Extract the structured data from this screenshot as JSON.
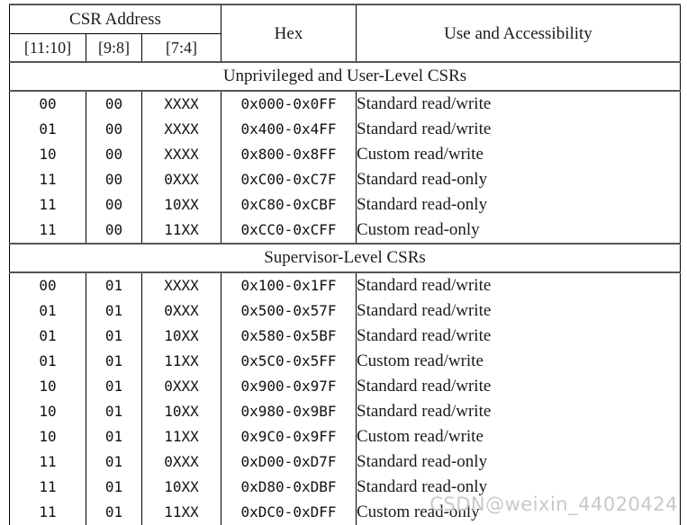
{
  "table": {
    "header": {
      "csr_address": "CSR Address",
      "bits_1": "[11:10]",
      "bits_2": "[9:8]",
      "bits_3": "[7:4]",
      "hex": "Hex",
      "use": "Use and Accessibility"
    },
    "sections": [
      {
        "title": "Unprivileged and User-Level CSRs",
        "rows": [
          {
            "bits1": "00",
            "bits2": "00",
            "bits3": "XXXX",
            "hex": "0x000-0x0FF",
            "use": "Standard read/write"
          },
          {
            "bits1": "01",
            "bits2": "00",
            "bits3": "XXXX",
            "hex": "0x400-0x4FF",
            "use": "Standard read/write"
          },
          {
            "bits1": "10",
            "bits2": "00",
            "bits3": "XXXX",
            "hex": "0x800-0x8FF",
            "use": "Custom read/write"
          },
          {
            "bits1": "11",
            "bits2": "00",
            "bits3": "0XXX",
            "hex": "0xC00-0xC7F",
            "use": "Standard read-only"
          },
          {
            "bits1": "11",
            "bits2": "00",
            "bits3": "10XX",
            "hex": "0xC80-0xCBF",
            "use": "Standard read-only"
          },
          {
            "bits1": "11",
            "bits2": "00",
            "bits3": "11XX",
            "hex": "0xCC0-0xCFF",
            "use": "Custom read-only"
          }
        ]
      },
      {
        "title": "Supervisor-Level CSRs",
        "rows": [
          {
            "bits1": "00",
            "bits2": "01",
            "bits3": "XXXX",
            "hex": "0x100-0x1FF",
            "use": "Standard read/write"
          },
          {
            "bits1": "01",
            "bits2": "01",
            "bits3": "0XXX",
            "hex": "0x500-0x57F",
            "use": "Standard read/write"
          },
          {
            "bits1": "01",
            "bits2": "01",
            "bits3": "10XX",
            "hex": "0x580-0x5BF",
            "use": "Standard read/write"
          },
          {
            "bits1": "01",
            "bits2": "01",
            "bits3": "11XX",
            "hex": "0x5C0-0x5FF",
            "use": "Custom read/write"
          },
          {
            "bits1": "10",
            "bits2": "01",
            "bits3": "0XXX",
            "hex": "0x900-0x97F",
            "use": "Standard read/write"
          },
          {
            "bits1": "10",
            "bits2": "01",
            "bits3": "10XX",
            "hex": "0x980-0x9BF",
            "use": "Standard read/write"
          },
          {
            "bits1": "10",
            "bits2": "01",
            "bits3": "11XX",
            "hex": "0x9C0-0x9FF",
            "use": "Custom read/write"
          },
          {
            "bits1": "11",
            "bits2": "01",
            "bits3": "0XXX",
            "hex": "0xD00-0xD7F",
            "use": "Standard read-only"
          },
          {
            "bits1": "11",
            "bits2": "01",
            "bits3": "10XX",
            "hex": "0xD80-0xDBF",
            "use": "Standard read-only"
          },
          {
            "bits1": "11",
            "bits2": "01",
            "bits3": "11XX",
            "hex": "0xDC0-0xDFF",
            "use": "Custom read-only"
          }
        ]
      }
    ]
  },
  "watermark": {
    "text": "CSDN@weixin_44020424"
  }
}
